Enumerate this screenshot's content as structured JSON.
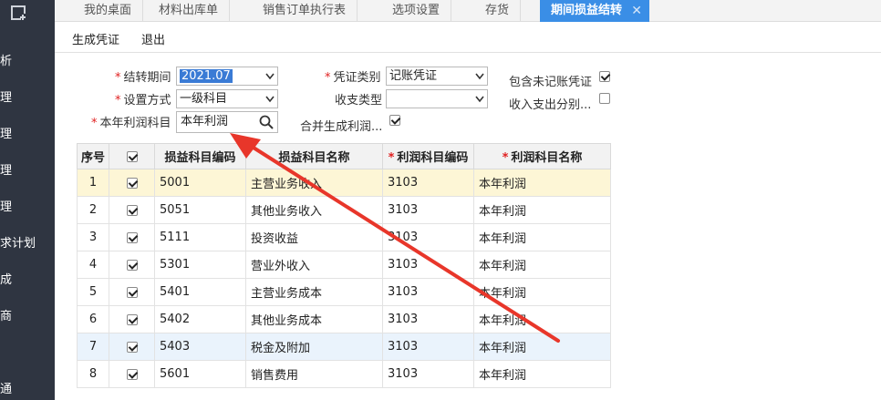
{
  "sidebar": {
    "items": [
      "析",
      "理",
      "理",
      "理",
      "理",
      "求计划",
      "成",
      "商",
      "通"
    ]
  },
  "tabs": [
    {
      "label": "我的桌面"
    },
    {
      "label": "材料出库单"
    },
    {
      "label": "销售订单执行表"
    },
    {
      "label": "选项设置"
    },
    {
      "label": "存货"
    },
    {
      "label": "期间损益结转",
      "active": true,
      "close": "✕"
    }
  ],
  "toolbar": {
    "generate_label": "生成凭证",
    "exit_label": "退出"
  },
  "form": {
    "period_label": "结转期间",
    "period_value": "2021.07",
    "method_label": "设置方式",
    "method_value": "一级科目",
    "profit_label": "本年利润科目",
    "profit_value": "本年利润",
    "voucher_type_label": "凭证类别",
    "voucher_type_value": "记账凭证",
    "income_type_label": "收支类型",
    "income_type_value": "",
    "merge_label": "合并生成利润...",
    "include_unposted_label": "包含未记账凭证",
    "income_split_label": "收入支出分别...",
    "required_mark": "*",
    "merge_checked": true,
    "include_unposted_checked": true,
    "income_split_checked": false
  },
  "table": {
    "headers": [
      "序号",
      "",
      "损益科目编码",
      "损益科目名称",
      "利润科目编码",
      "利润科目名称"
    ],
    "required_mark": "*",
    "rows": [
      {
        "idx": "1",
        "checked": true,
        "code": "5001",
        "name": "主营业务收入",
        "pcode": "3103",
        "pname": "本年利润"
      },
      {
        "idx": "2",
        "checked": true,
        "code": "5051",
        "name": "其他业务收入",
        "pcode": "3103",
        "pname": "本年利润"
      },
      {
        "idx": "3",
        "checked": true,
        "code": "5111",
        "name": "投资收益",
        "pcode": "3103",
        "pname": "本年利润"
      },
      {
        "idx": "4",
        "checked": true,
        "code": "5301",
        "name": "营业外收入",
        "pcode": "3103",
        "pname": "本年利润"
      },
      {
        "idx": "5",
        "checked": true,
        "code": "5401",
        "name": "主营业务成本",
        "pcode": "3103",
        "pname": "本年利润"
      },
      {
        "idx": "6",
        "checked": true,
        "code": "5402",
        "name": "其他业务成本",
        "pcode": "3103",
        "pname": "本年利润"
      },
      {
        "idx": "7",
        "checked": true,
        "code": "5403",
        "name": "税金及附加",
        "pcode": "3103",
        "pname": "本年利润"
      },
      {
        "idx": "8",
        "checked": true,
        "code": "5601",
        "name": "销售费用",
        "pcode": "3103",
        "pname": "本年利润"
      }
    ]
  },
  "colors": {
    "sidebar_bg": "#2f3541",
    "tab_active_bg": "#3a8ee6",
    "highlight_row": "#fdf6d6",
    "selected_row": "#eaf3fc",
    "annotation_arrow": "#e8362a"
  },
  "icons": {
    "logo": "app-logo-icon",
    "search": "search-icon",
    "dropdown": "chevron-down-icon"
  }
}
